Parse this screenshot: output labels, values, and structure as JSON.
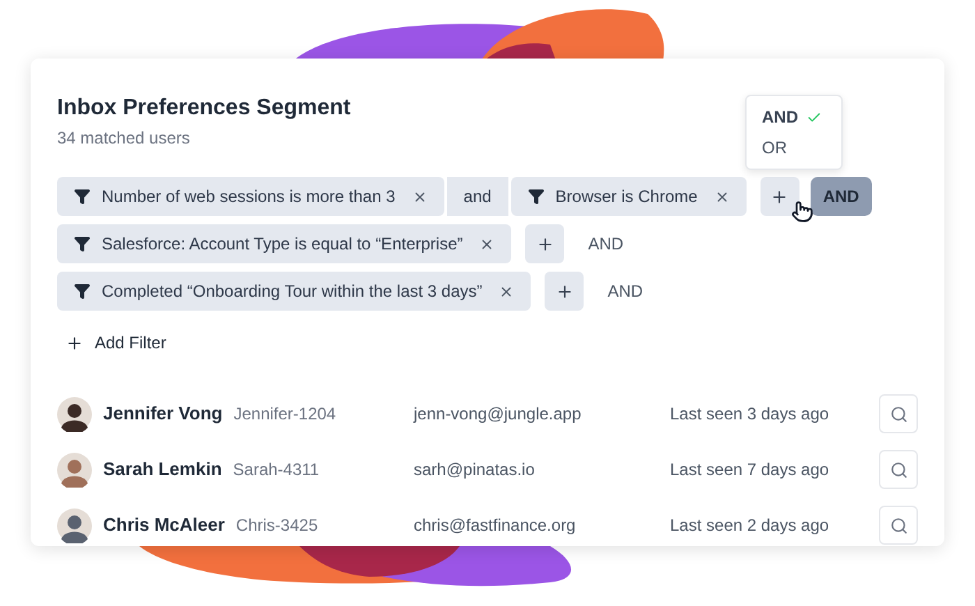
{
  "segment": {
    "title": "Inbox Preferences Segment",
    "subtitle": "34 matched users"
  },
  "combinator_menu": [
    {
      "label": "AND",
      "selected": true
    },
    {
      "label": "OR",
      "selected": false
    }
  ],
  "filter_rows": [
    {
      "items": [
        {
          "kind": "filter",
          "label": "Number of web sessions is more than 3"
        },
        {
          "kind": "connector",
          "label": "and"
        },
        {
          "kind": "filter",
          "label": "Browser is Chrome"
        }
      ],
      "combinator": {
        "label": "AND",
        "active": true
      }
    },
    {
      "items": [
        {
          "kind": "filter",
          "label": "Salesforce: Account Type is equal to “Enterprise”"
        }
      ],
      "combinator": {
        "label": "AND",
        "active": false
      }
    },
    {
      "items": [
        {
          "kind": "filter",
          "label": "Completed “Onboarding Tour within the last 3 days”"
        }
      ],
      "combinator": {
        "label": "AND",
        "active": false
      }
    }
  ],
  "add_filter": {
    "label": "Add Filter"
  },
  "users": [
    {
      "name": "Jennifer Vong",
      "handle": "Jennifer-1204",
      "email": "jenn-vong@jungle.app",
      "last_seen": "Last seen 3 days ago",
      "color": "#3b2a25"
    },
    {
      "name": "Sarah Lemkin",
      "handle": "Sarah-4311",
      "email": "sarh@pinatas.io",
      "last_seen": "Last seen 7 days ago",
      "color": "#a0705a"
    },
    {
      "name": "Chris McAleer",
      "handle": "Chris-3425",
      "email": "chris@fastfinance.org",
      "last_seen": "Last seen 2 days ago",
      "color": "#5a6270"
    }
  ]
}
